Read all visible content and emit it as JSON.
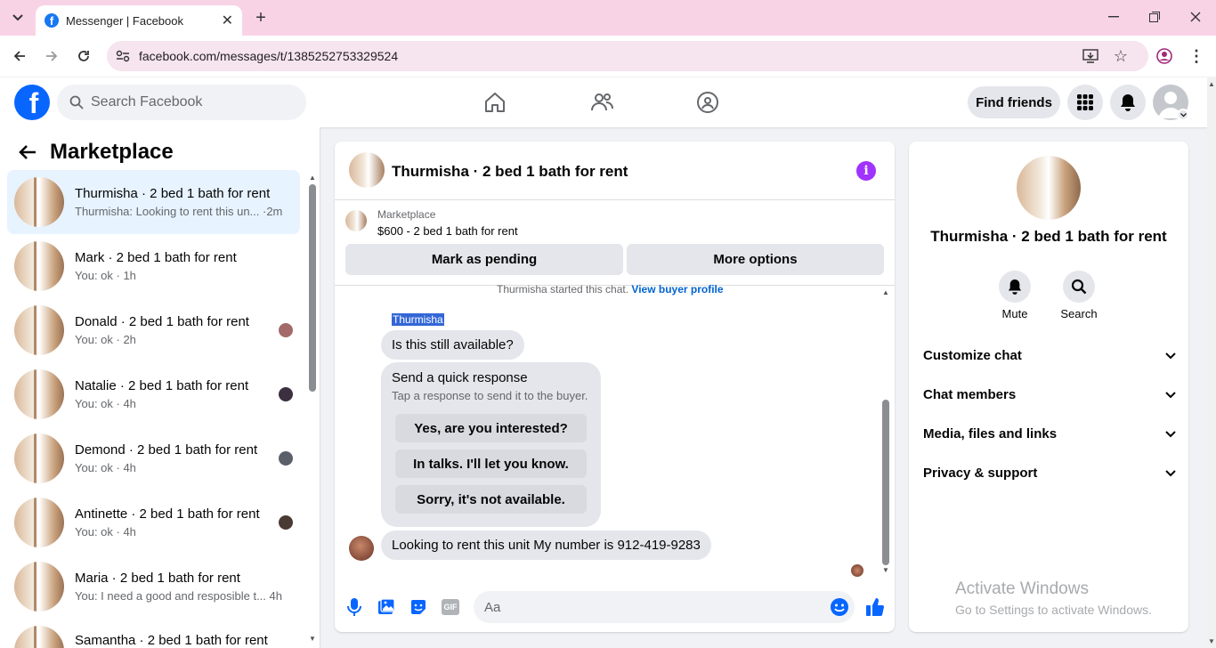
{
  "browser": {
    "tab_title": "Messenger | Facebook",
    "url": "facebook.com/messages/t/1385252753329524"
  },
  "fb": {
    "search_placeholder": "Search Facebook",
    "find_friends": "Find friends"
  },
  "sidebar": {
    "title": "Marketplace",
    "conversations": [
      {
        "name": "Thurmisha · 2 bed 1 bath for rent",
        "preview": "Thurmisha: Looking to rent this un... ·2m"
      },
      {
        "name": "Mark · 2 bed 1 bath for rent",
        "preview": "You: ok · 1h"
      },
      {
        "name": "Donald · 2 bed 1 bath for rent",
        "preview": "You: ok · 2h"
      },
      {
        "name": "Natalie · 2 bed 1 bath for rent",
        "preview": "You: ok · 4h"
      },
      {
        "name": "Demond · 2 bed 1 bath for rent",
        "preview": "You: ok · 4h"
      },
      {
        "name": "Antinette · 2 bed 1 bath for rent",
        "preview": "You: ok · 4h"
      },
      {
        "name": "Maria · 2 bed 1 bath for rent",
        "preview": "You: I need a good and resposible t...   4h"
      },
      {
        "name": "Samantha · 2 bed 1 bath for rent",
        "preview": ""
      }
    ]
  },
  "chat": {
    "title": "Thurmisha · 2 bed 1 bath for rent",
    "listing_source": "Marketplace",
    "listing_title": "$600 - 2 bed 1 bath for rent",
    "mark_pending": "Mark as pending",
    "more_options": "More options",
    "started_text": "Thurmisha started this chat.",
    "view_profile": "View buyer profile",
    "sender_name": "Thurmisha",
    "msg1": "Is this still available?",
    "quick_title": "Send a quick response",
    "quick_sub": "Tap a response to send it to the buyer.",
    "quick_responses": [
      "Yes, are you interested?",
      "In talks. I'll let you know.",
      "Sorry, it's not available."
    ],
    "msg2": "Looking to rent this unit My number is 912-419-9283",
    "input_placeholder": "Aa"
  },
  "info": {
    "name": "Thurmisha · 2 bed 1 bath for rent",
    "mute": "Mute",
    "search": "Search",
    "sections": [
      "Customize chat",
      "Chat members",
      "Media, files and links",
      "Privacy & support"
    ]
  },
  "watermark": {
    "line1": "Activate Windows",
    "line2": "Go to Settings to activate Windows."
  }
}
